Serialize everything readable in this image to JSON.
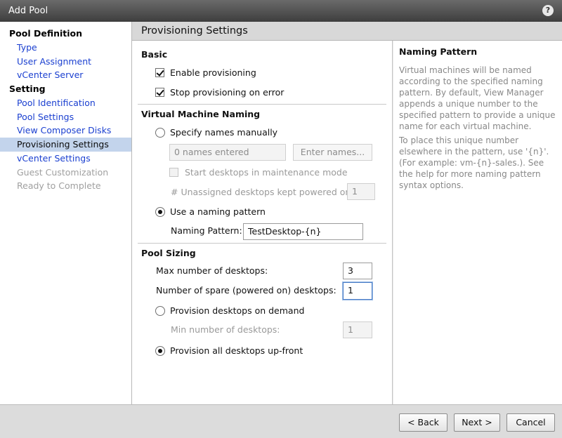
{
  "window": {
    "title": "Add Pool",
    "help": "?"
  },
  "sidebar": {
    "items": [
      {
        "label": "Pool Definition",
        "kind": "head"
      },
      {
        "label": "Type",
        "kind": "link"
      },
      {
        "label": "User Assignment",
        "kind": "link"
      },
      {
        "label": "vCenter Server",
        "kind": "link"
      },
      {
        "label": "Setting",
        "kind": "head"
      },
      {
        "label": "Pool Identification",
        "kind": "link"
      },
      {
        "label": "Pool Settings",
        "kind": "link"
      },
      {
        "label": "View Composer Disks",
        "kind": "link"
      },
      {
        "label": "Provisioning Settings",
        "kind": "active"
      },
      {
        "label": "vCenter Settings",
        "kind": "link"
      },
      {
        "label": "Guest Customization",
        "kind": "disabled"
      },
      {
        "label": "Ready to Complete",
        "kind": "disabled"
      }
    ]
  },
  "header": {
    "title": "Provisioning Settings"
  },
  "basic": {
    "title": "Basic",
    "enable_provisioning": "Enable provisioning",
    "stop_on_error": "Stop provisioning on error"
  },
  "naming": {
    "title": "Virtual Machine Naming",
    "specify_manually": "Specify names manually",
    "names_entered": "0 names entered",
    "enter_names": "Enter names...",
    "maintenance_mode": "Start desktops in maintenance mode",
    "unassigned_label": "# Unassigned desktops kept powered on:",
    "unassigned_value": "1",
    "use_pattern": "Use a naming pattern",
    "pattern_label": "Naming Pattern:",
    "pattern_value": "TestDesktop-{n}"
  },
  "sizing": {
    "title": "Pool Sizing",
    "max_label": "Max number of desktops:",
    "max_value": "3",
    "spare_label": "Number of spare (powered on) desktops:",
    "spare_value": "1",
    "on_demand": "Provision desktops on demand",
    "min_label": "Min number of desktops:",
    "min_value": "1",
    "upfront": "Provision all desktops up-front"
  },
  "info": {
    "title": "Naming Pattern",
    "para1": "Virtual machines will be named according to the specified naming pattern. By default, View Manager appends a unique number to the specified pattern to provide a unique name for each virtual machine.",
    "para2": "To place this unique number elsewhere in the pattern, use '{n}'. (For example: vm-{n}-sales.). See the help for more naming pattern syntax options."
  },
  "footer": {
    "back": "< Back",
    "next": "Next >",
    "cancel": "Cancel"
  }
}
